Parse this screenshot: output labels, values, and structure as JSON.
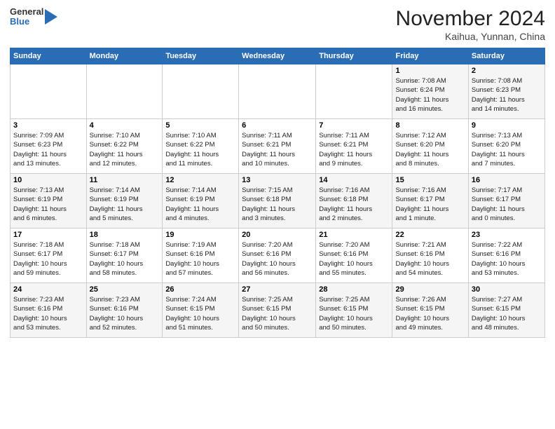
{
  "header": {
    "logo_general": "General",
    "logo_blue": "Blue",
    "month_title": "November 2024",
    "location": "Kaihua, Yunnan, China"
  },
  "weekdays": [
    "Sunday",
    "Monday",
    "Tuesday",
    "Wednesday",
    "Thursday",
    "Friday",
    "Saturday"
  ],
  "weeks": [
    [
      {
        "day": "",
        "info": ""
      },
      {
        "day": "",
        "info": ""
      },
      {
        "day": "",
        "info": ""
      },
      {
        "day": "",
        "info": ""
      },
      {
        "day": "",
        "info": ""
      },
      {
        "day": "1",
        "info": "Sunrise: 7:08 AM\nSunset: 6:24 PM\nDaylight: 11 hours\nand 16 minutes."
      },
      {
        "day": "2",
        "info": "Sunrise: 7:08 AM\nSunset: 6:23 PM\nDaylight: 11 hours\nand 14 minutes."
      }
    ],
    [
      {
        "day": "3",
        "info": "Sunrise: 7:09 AM\nSunset: 6:23 PM\nDaylight: 11 hours\nand 13 minutes."
      },
      {
        "day": "4",
        "info": "Sunrise: 7:10 AM\nSunset: 6:22 PM\nDaylight: 11 hours\nand 12 minutes."
      },
      {
        "day": "5",
        "info": "Sunrise: 7:10 AM\nSunset: 6:22 PM\nDaylight: 11 hours\nand 11 minutes."
      },
      {
        "day": "6",
        "info": "Sunrise: 7:11 AM\nSunset: 6:21 PM\nDaylight: 11 hours\nand 10 minutes."
      },
      {
        "day": "7",
        "info": "Sunrise: 7:11 AM\nSunset: 6:21 PM\nDaylight: 11 hours\nand 9 minutes."
      },
      {
        "day": "8",
        "info": "Sunrise: 7:12 AM\nSunset: 6:20 PM\nDaylight: 11 hours\nand 8 minutes."
      },
      {
        "day": "9",
        "info": "Sunrise: 7:13 AM\nSunset: 6:20 PM\nDaylight: 11 hours\nand 7 minutes."
      }
    ],
    [
      {
        "day": "10",
        "info": "Sunrise: 7:13 AM\nSunset: 6:19 PM\nDaylight: 11 hours\nand 6 minutes."
      },
      {
        "day": "11",
        "info": "Sunrise: 7:14 AM\nSunset: 6:19 PM\nDaylight: 11 hours\nand 5 minutes."
      },
      {
        "day": "12",
        "info": "Sunrise: 7:14 AM\nSunset: 6:19 PM\nDaylight: 11 hours\nand 4 minutes."
      },
      {
        "day": "13",
        "info": "Sunrise: 7:15 AM\nSunset: 6:18 PM\nDaylight: 11 hours\nand 3 minutes."
      },
      {
        "day": "14",
        "info": "Sunrise: 7:16 AM\nSunset: 6:18 PM\nDaylight: 11 hours\nand 2 minutes."
      },
      {
        "day": "15",
        "info": "Sunrise: 7:16 AM\nSunset: 6:17 PM\nDaylight: 11 hours\nand 1 minute."
      },
      {
        "day": "16",
        "info": "Sunrise: 7:17 AM\nSunset: 6:17 PM\nDaylight: 11 hours\nand 0 minutes."
      }
    ],
    [
      {
        "day": "17",
        "info": "Sunrise: 7:18 AM\nSunset: 6:17 PM\nDaylight: 10 hours\nand 59 minutes."
      },
      {
        "day": "18",
        "info": "Sunrise: 7:18 AM\nSunset: 6:17 PM\nDaylight: 10 hours\nand 58 minutes."
      },
      {
        "day": "19",
        "info": "Sunrise: 7:19 AM\nSunset: 6:16 PM\nDaylight: 10 hours\nand 57 minutes."
      },
      {
        "day": "20",
        "info": "Sunrise: 7:20 AM\nSunset: 6:16 PM\nDaylight: 10 hours\nand 56 minutes."
      },
      {
        "day": "21",
        "info": "Sunrise: 7:20 AM\nSunset: 6:16 PM\nDaylight: 10 hours\nand 55 minutes."
      },
      {
        "day": "22",
        "info": "Sunrise: 7:21 AM\nSunset: 6:16 PM\nDaylight: 10 hours\nand 54 minutes."
      },
      {
        "day": "23",
        "info": "Sunrise: 7:22 AM\nSunset: 6:16 PM\nDaylight: 10 hours\nand 53 minutes."
      }
    ],
    [
      {
        "day": "24",
        "info": "Sunrise: 7:23 AM\nSunset: 6:16 PM\nDaylight: 10 hours\nand 53 minutes."
      },
      {
        "day": "25",
        "info": "Sunrise: 7:23 AM\nSunset: 6:16 PM\nDaylight: 10 hours\nand 52 minutes."
      },
      {
        "day": "26",
        "info": "Sunrise: 7:24 AM\nSunset: 6:15 PM\nDaylight: 10 hours\nand 51 minutes."
      },
      {
        "day": "27",
        "info": "Sunrise: 7:25 AM\nSunset: 6:15 PM\nDaylight: 10 hours\nand 50 minutes."
      },
      {
        "day": "28",
        "info": "Sunrise: 7:25 AM\nSunset: 6:15 PM\nDaylight: 10 hours\nand 50 minutes."
      },
      {
        "day": "29",
        "info": "Sunrise: 7:26 AM\nSunset: 6:15 PM\nDaylight: 10 hours\nand 49 minutes."
      },
      {
        "day": "30",
        "info": "Sunrise: 7:27 AM\nSunset: 6:15 PM\nDaylight: 10 hours\nand 48 minutes."
      }
    ]
  ]
}
